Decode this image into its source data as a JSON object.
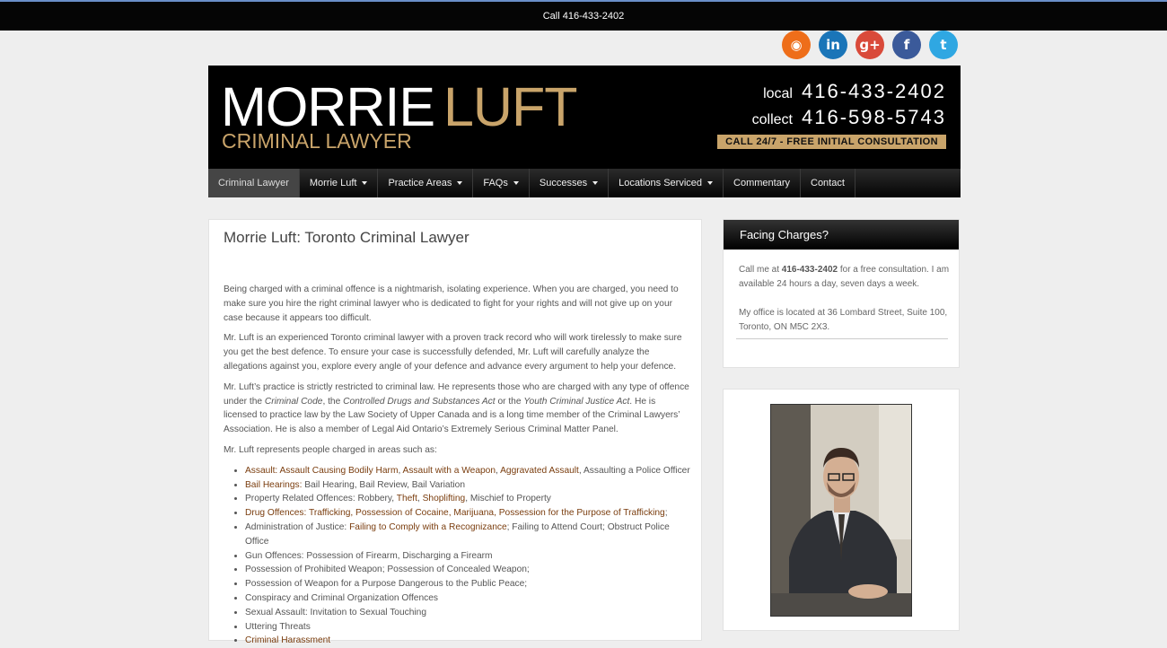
{
  "topbar": {
    "text": "Call 416-433-2402"
  },
  "social": [
    {
      "icon": "rss-icon",
      "glyph": "◉",
      "color": "#ee6e1a"
    },
    {
      "icon": "linkedin-icon",
      "glyph": "in",
      "color": "#1a75b8"
    },
    {
      "icon": "google-plus-icon",
      "glyph": "g+",
      "color": "#d94a3a"
    },
    {
      "icon": "facebook-icon",
      "glyph": "f",
      "color": "#3b5a9a"
    },
    {
      "icon": "twitter-icon",
      "glyph": "t",
      "color": "#2fa7e2"
    }
  ],
  "header": {
    "logo_white": "MORRIE",
    "logo_gold": "LUFT",
    "logo_sub": "CRIMINAL LAWYER",
    "local_label": "local",
    "local_number": "416-433-2402",
    "collect_label": "collect",
    "collect_number": "416-598-5743",
    "cta": "CALL 24/7 - FREE INITIAL CONSULTATION"
  },
  "nav": [
    {
      "label": "Criminal Lawyer",
      "active": true,
      "dropdown": false
    },
    {
      "label": "Morrie Luft",
      "dropdown": true
    },
    {
      "label": "Practice Areas",
      "dropdown": true
    },
    {
      "label": "FAQs",
      "dropdown": true
    },
    {
      "label": "Successes",
      "dropdown": true
    },
    {
      "label": "Locations Serviced",
      "dropdown": true
    },
    {
      "label": "Commentary",
      "dropdown": false
    },
    {
      "label": "Contact",
      "dropdown": false
    }
  ],
  "main": {
    "title": "Morrie Luft: Toronto Criminal Lawyer",
    "p1": "Being charged with a criminal offence is a nightmarish, isolating experience. When you are charged, you need to make sure you hire the right criminal lawyer who is dedicated to fight for your rights and will not give up on your case because it appears too difficult.",
    "p2": "Mr. Luft is an experienced Toronto criminal lawyer with a proven track record who will work tirelessly to make sure you get the best defence. To ensure your case is successfully defended, Mr. Luft will carefully analyze the allegations against you, explore every angle of your defence and advance every argument to help your defence.",
    "p3_a": "Mr. Luft’s practice is strictly restricted to criminal law.  He represents those who are charged with any type of offence under the ",
    "p3_b": "Criminal Code",
    "p3_c": ", the ",
    "p3_d": "Controlled Drugs and Substances Act",
    "p3_e": " or the ",
    "p3_f": "Youth Criminal Justice Act",
    "p3_g": ". He is licensed to practice law by the Law Society of Upper Canada and is a long time member of the Criminal Lawyers’ Association.  He is also a member of Legal Aid Ontario’s Extremely Serious Criminal Matter Panel.",
    "p4": "Mr. Luft represents people charged in areas such as:",
    "list": [
      [
        {
          "t": "Assault: Assault Causing Bodily Harm",
          "l": true
        },
        {
          "t": ", ",
          "l": false
        },
        {
          "t": "Assault with a Weapon",
          "l": true
        },
        {
          "t": ", ",
          "l": false
        },
        {
          "t": "Aggravated Assault",
          "l": true
        },
        {
          "t": ", Assaulting a Police Officer",
          "l": false
        }
      ],
      [
        {
          "t": "Bail Hearings:",
          "l": true
        },
        {
          "t": " Bail Hearing, Bail Review, Bail Variation",
          "l": false
        }
      ],
      [
        {
          "t": "Property Related Offences: Robbery, ",
          "l": false
        },
        {
          "t": "Theft",
          "l": true
        },
        {
          "t": ", ",
          "l": false
        },
        {
          "t": "Shoplifting",
          "l": true
        },
        {
          "t": ", Mischief to Property",
          "l": false
        }
      ],
      [
        {
          "t": "Drug Offences: Trafficking, Possession of Cocaine, Marijuana, Possession for the Purpose of Trafficking",
          "l": true
        },
        {
          "t": ";",
          "l": false
        }
      ],
      [
        {
          "t": "Administration of Justice: ",
          "l": false
        },
        {
          "t": "Failing to Comply with a Recognizance",
          "l": true
        },
        {
          "t": "; Failing to Attend Court; Obstruct Police Office",
          "l": false
        }
      ],
      [
        {
          "t": "Gun Offences: Possession of Firearm, Discharging a Firearm",
          "l": false
        }
      ],
      [
        {
          "t": "Possession of Prohibited Weapon; Possession of Concealed Weapon;",
          "l": false
        }
      ],
      [
        {
          "t": "Possession of Weapon for a Purpose Dangerous to the Public Peace;",
          "l": false
        }
      ],
      [
        {
          "t": "Conspiracy and Criminal Organization Offences",
          "l": false
        }
      ],
      [
        {
          "t": "Sexual Assault: Invitation to Sexual Touching",
          "l": false
        }
      ],
      [
        {
          "t": "Uttering Threats",
          "l": false
        }
      ],
      [
        {
          "t": "Criminal Harassment",
          "l": true
        }
      ]
    ]
  },
  "sidebar": {
    "heading": "Facing Charges?",
    "text1_a": "Call me at ",
    "text1_b": "416-433-2402",
    "text1_c": " for a free consultation. I am available 24 hours a day, seven days a week.",
    "text2": "My office is located at 36 Lombard Street, Suite 100, Toronto, ON M5C 2X3."
  }
}
